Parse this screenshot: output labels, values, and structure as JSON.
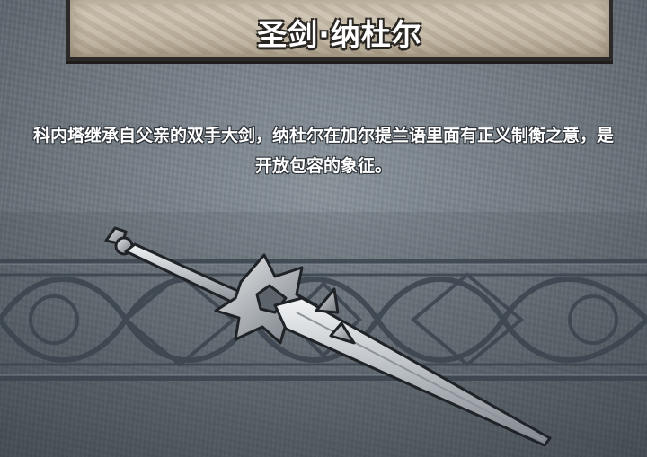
{
  "item": {
    "title": "圣剑·纳杜尔",
    "description": "科内塔继承自父亲的双手大剑，纳杜尔在加尔提兰语里面有正义制衡之意，是开放包容的象征。"
  },
  "colors": {
    "background": "#6f7880",
    "title_plate": "#c9bfad",
    "ornament_line": "#3d4650",
    "blade": "#d8dcdf"
  }
}
